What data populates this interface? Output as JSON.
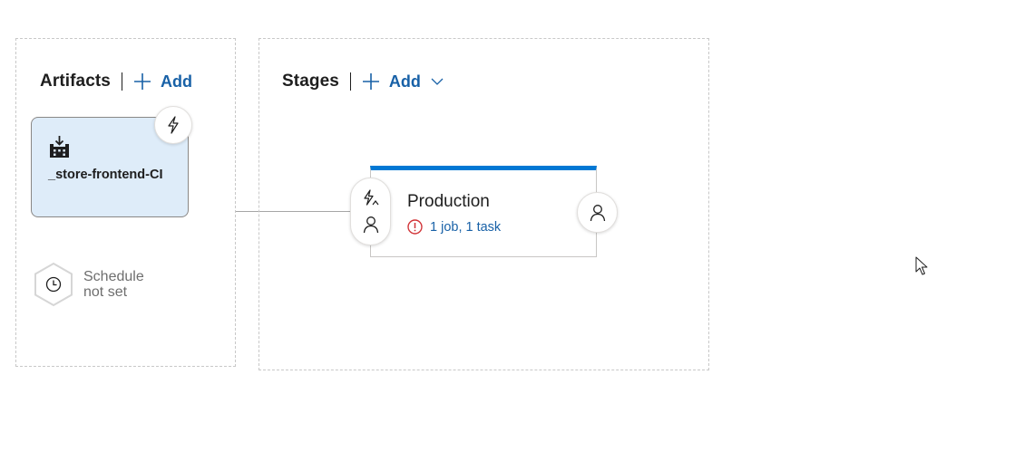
{
  "artifacts_panel": {
    "title": "Artifacts",
    "add_label": "Add",
    "artifact": {
      "name": "_store-frontend-CI",
      "icon": "build-icon"
    },
    "trigger_icon": "lightning-icon",
    "schedule": {
      "line1": "Schedule",
      "line2": "not set",
      "icon": "clock-icon"
    }
  },
  "stages_panel": {
    "title": "Stages",
    "add_label": "Add",
    "stage": {
      "name": "Production",
      "status": "1 job, 1 task",
      "status_icon": "error-icon"
    }
  },
  "colors": {
    "accent": "#0078d4",
    "link": "#1861a7",
    "artifact_bg": "#deecf9",
    "error": "#d13438"
  }
}
